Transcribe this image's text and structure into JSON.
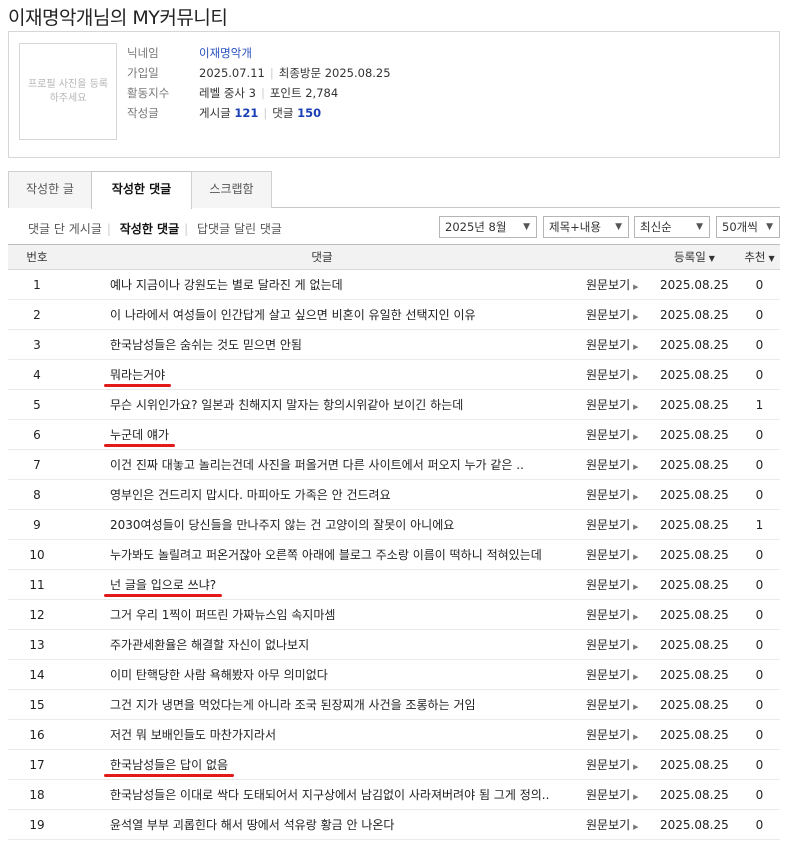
{
  "page_title": "이재명악개님의 MY커뮤니티",
  "profile": {
    "avatar_text": "프로필 사진을 등록하주세요",
    "nickname_label": "닉네임",
    "nickname": "이재명악개",
    "joined_label": "가입일",
    "joined": "2025.07.11",
    "last_visit_label": "최종방문",
    "last_visit": "2025.08.25",
    "activity_label": "활동지수",
    "level": "레벨 중사 3",
    "points": "포인트 2,784",
    "written_label": "작성글",
    "posts_label": "게시글",
    "posts_count": "121",
    "comments_label": "댓글",
    "comments_count": "150"
  },
  "tabs": [
    "작성한 글",
    "작성한 댓글",
    "스크랩함"
  ],
  "subfilters": [
    "댓글 단 게시글",
    "작성한 댓글",
    "답댓글 달린 댓글"
  ],
  "selects": {
    "month": "2025년 8월",
    "scope": "제목+내용",
    "order": "최신순",
    "per_page": "50개씩"
  },
  "table": {
    "headers": {
      "no": "번호",
      "comment": "댓글",
      "date": "등록일",
      "rec": "추천"
    },
    "view_label": "원문보기",
    "rows": [
      {
        "no": "1",
        "text": "예나 지금이나 강원도는 별로 달라진 게 없는데",
        "date": "2025.08.25",
        "rec": "0",
        "underline": false
      },
      {
        "no": "2",
        "text": "이 나라에서 여성들이 인간답게 살고 싶으면 비혼이 유일한 선택지인 이유",
        "date": "2025.08.25",
        "rec": "0",
        "underline": false
      },
      {
        "no": "3",
        "text": "한국남성들은 숨쉬는 것도 믿으면 안됨",
        "date": "2025.08.25",
        "rec": "0",
        "underline": false
      },
      {
        "no": "4",
        "text": "뭐라는거야",
        "date": "2025.08.25",
        "rec": "0",
        "underline": true
      },
      {
        "no": "5",
        "text": "무슨 시위인가요? 일본과 친해지지 말자는 항의시위같아 보이긴 하는데",
        "date": "2025.08.25",
        "rec": "1",
        "underline": false
      },
      {
        "no": "6",
        "text": "누군데 얘가",
        "date": "2025.08.25",
        "rec": "0",
        "underline": true
      },
      {
        "no": "7",
        "text": "이건 진짜 대놓고 놀리는건데 사진을 퍼올거면 다른 사이트에서 퍼오지 누가 같은 ..",
        "date": "2025.08.25",
        "rec": "0",
        "underline": false
      },
      {
        "no": "8",
        "text": "영부인은 건드리지 맙시다. 마피아도 가족은 안 건드려요",
        "date": "2025.08.25",
        "rec": "0",
        "underline": false
      },
      {
        "no": "9",
        "text": "2030여성들이 당신들을 만나주지 않는 건 고양이의 잘못이 아니에요",
        "date": "2025.08.25",
        "rec": "1",
        "underline": false
      },
      {
        "no": "10",
        "text": "누가봐도 놀릴려고 퍼온거잖아 오른쪽 아래에 블로그 주소랑 이름이 떡하니 적혀있는데",
        "date": "2025.08.25",
        "rec": "0",
        "underline": false
      },
      {
        "no": "11",
        "text": "넌 글을 입으로 쓰냐?",
        "date": "2025.08.25",
        "rec": "0",
        "underline": true
      },
      {
        "no": "12",
        "text": "그거 우리 1찍이 퍼뜨린 가짜뉴스임 속지마셈",
        "date": "2025.08.25",
        "rec": "0",
        "underline": false
      },
      {
        "no": "13",
        "text": "주가관세환율은 해결할 자신이 없나보지",
        "date": "2025.08.25",
        "rec": "0",
        "underline": false
      },
      {
        "no": "14",
        "text": "이미 탄핵당한 사람 욕해봤자 아무 의미없다",
        "date": "2025.08.25",
        "rec": "0",
        "underline": false
      },
      {
        "no": "15",
        "text": "그건 지가 냉면을 먹었다는게 아니라 조국 된장찌개 사건을 조롱하는 거임",
        "date": "2025.08.25",
        "rec": "0",
        "underline": false
      },
      {
        "no": "16",
        "text": "저건 뭐 보배인들도 마찬가지라서",
        "date": "2025.08.25",
        "rec": "0",
        "underline": false
      },
      {
        "no": "17",
        "text": "한국남성들은 답이 없음",
        "date": "2025.08.25",
        "rec": "0",
        "underline": true
      },
      {
        "no": "18",
        "text": "한국남성들은 이대로 싹다 도태되어서 지구상에서 남김없이 사라져버려야 됨 그게 정의..",
        "date": "2025.08.25",
        "rec": "0",
        "underline": false
      },
      {
        "no": "19",
        "text": "윤석열 부부 괴롭힌다 해서 땅에서 석유랑 황금 안 나온다",
        "date": "2025.08.25",
        "rec": "0",
        "underline": false
      }
    ]
  }
}
